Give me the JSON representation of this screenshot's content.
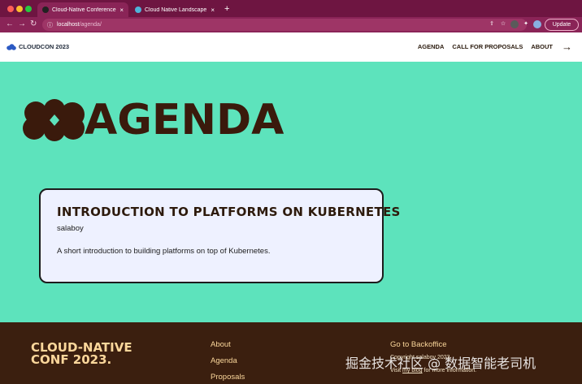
{
  "browser": {
    "tabs": [
      {
        "title": "Cloud-Native Conference 2023",
        "active": true
      },
      {
        "title": "Cloud Native Landscape",
        "active": false
      }
    ],
    "url_host": "localhost",
    "url_path": "/agenda/",
    "update_label": "Update",
    "new_tab_label": "+",
    "close_label": "×"
  },
  "site": {
    "brand": "CLOUDCON 2023",
    "nav": [
      "AGENDA",
      "CALL FOR PROPOSALS",
      "ABOUT"
    ],
    "arrow": "→"
  },
  "hero": {
    "title": "AGENDA"
  },
  "session": {
    "title": "INTRODUCTION TO PLATFORMS ON KUBERNETES",
    "author": "salaboy",
    "description": "A short introduction to building platforms on top of Kubernetes."
  },
  "footer": {
    "brand_line1": "CLOUD-NATIVE",
    "brand_line2": "CONF 2023.",
    "links": [
      "About",
      "Agenda",
      "Proposals"
    ],
    "backoffice": "Go to Backoffice",
    "copyright": "Copyright salaboy 2023",
    "visit_prefix": "Visit ",
    "visit_link": "my blog",
    "visit_suffix": " for more information."
  },
  "watermark": "掘金技术社区 @ 数据智能老司机",
  "colors": {
    "brand_green": "#5de3bc",
    "dark_brown": "#3a1a0c",
    "footer_bg": "#3b1f0f",
    "footer_text": "#fbd79b",
    "card_bg": "#eef1ff",
    "chrome_bg": "#7a1b4a"
  }
}
